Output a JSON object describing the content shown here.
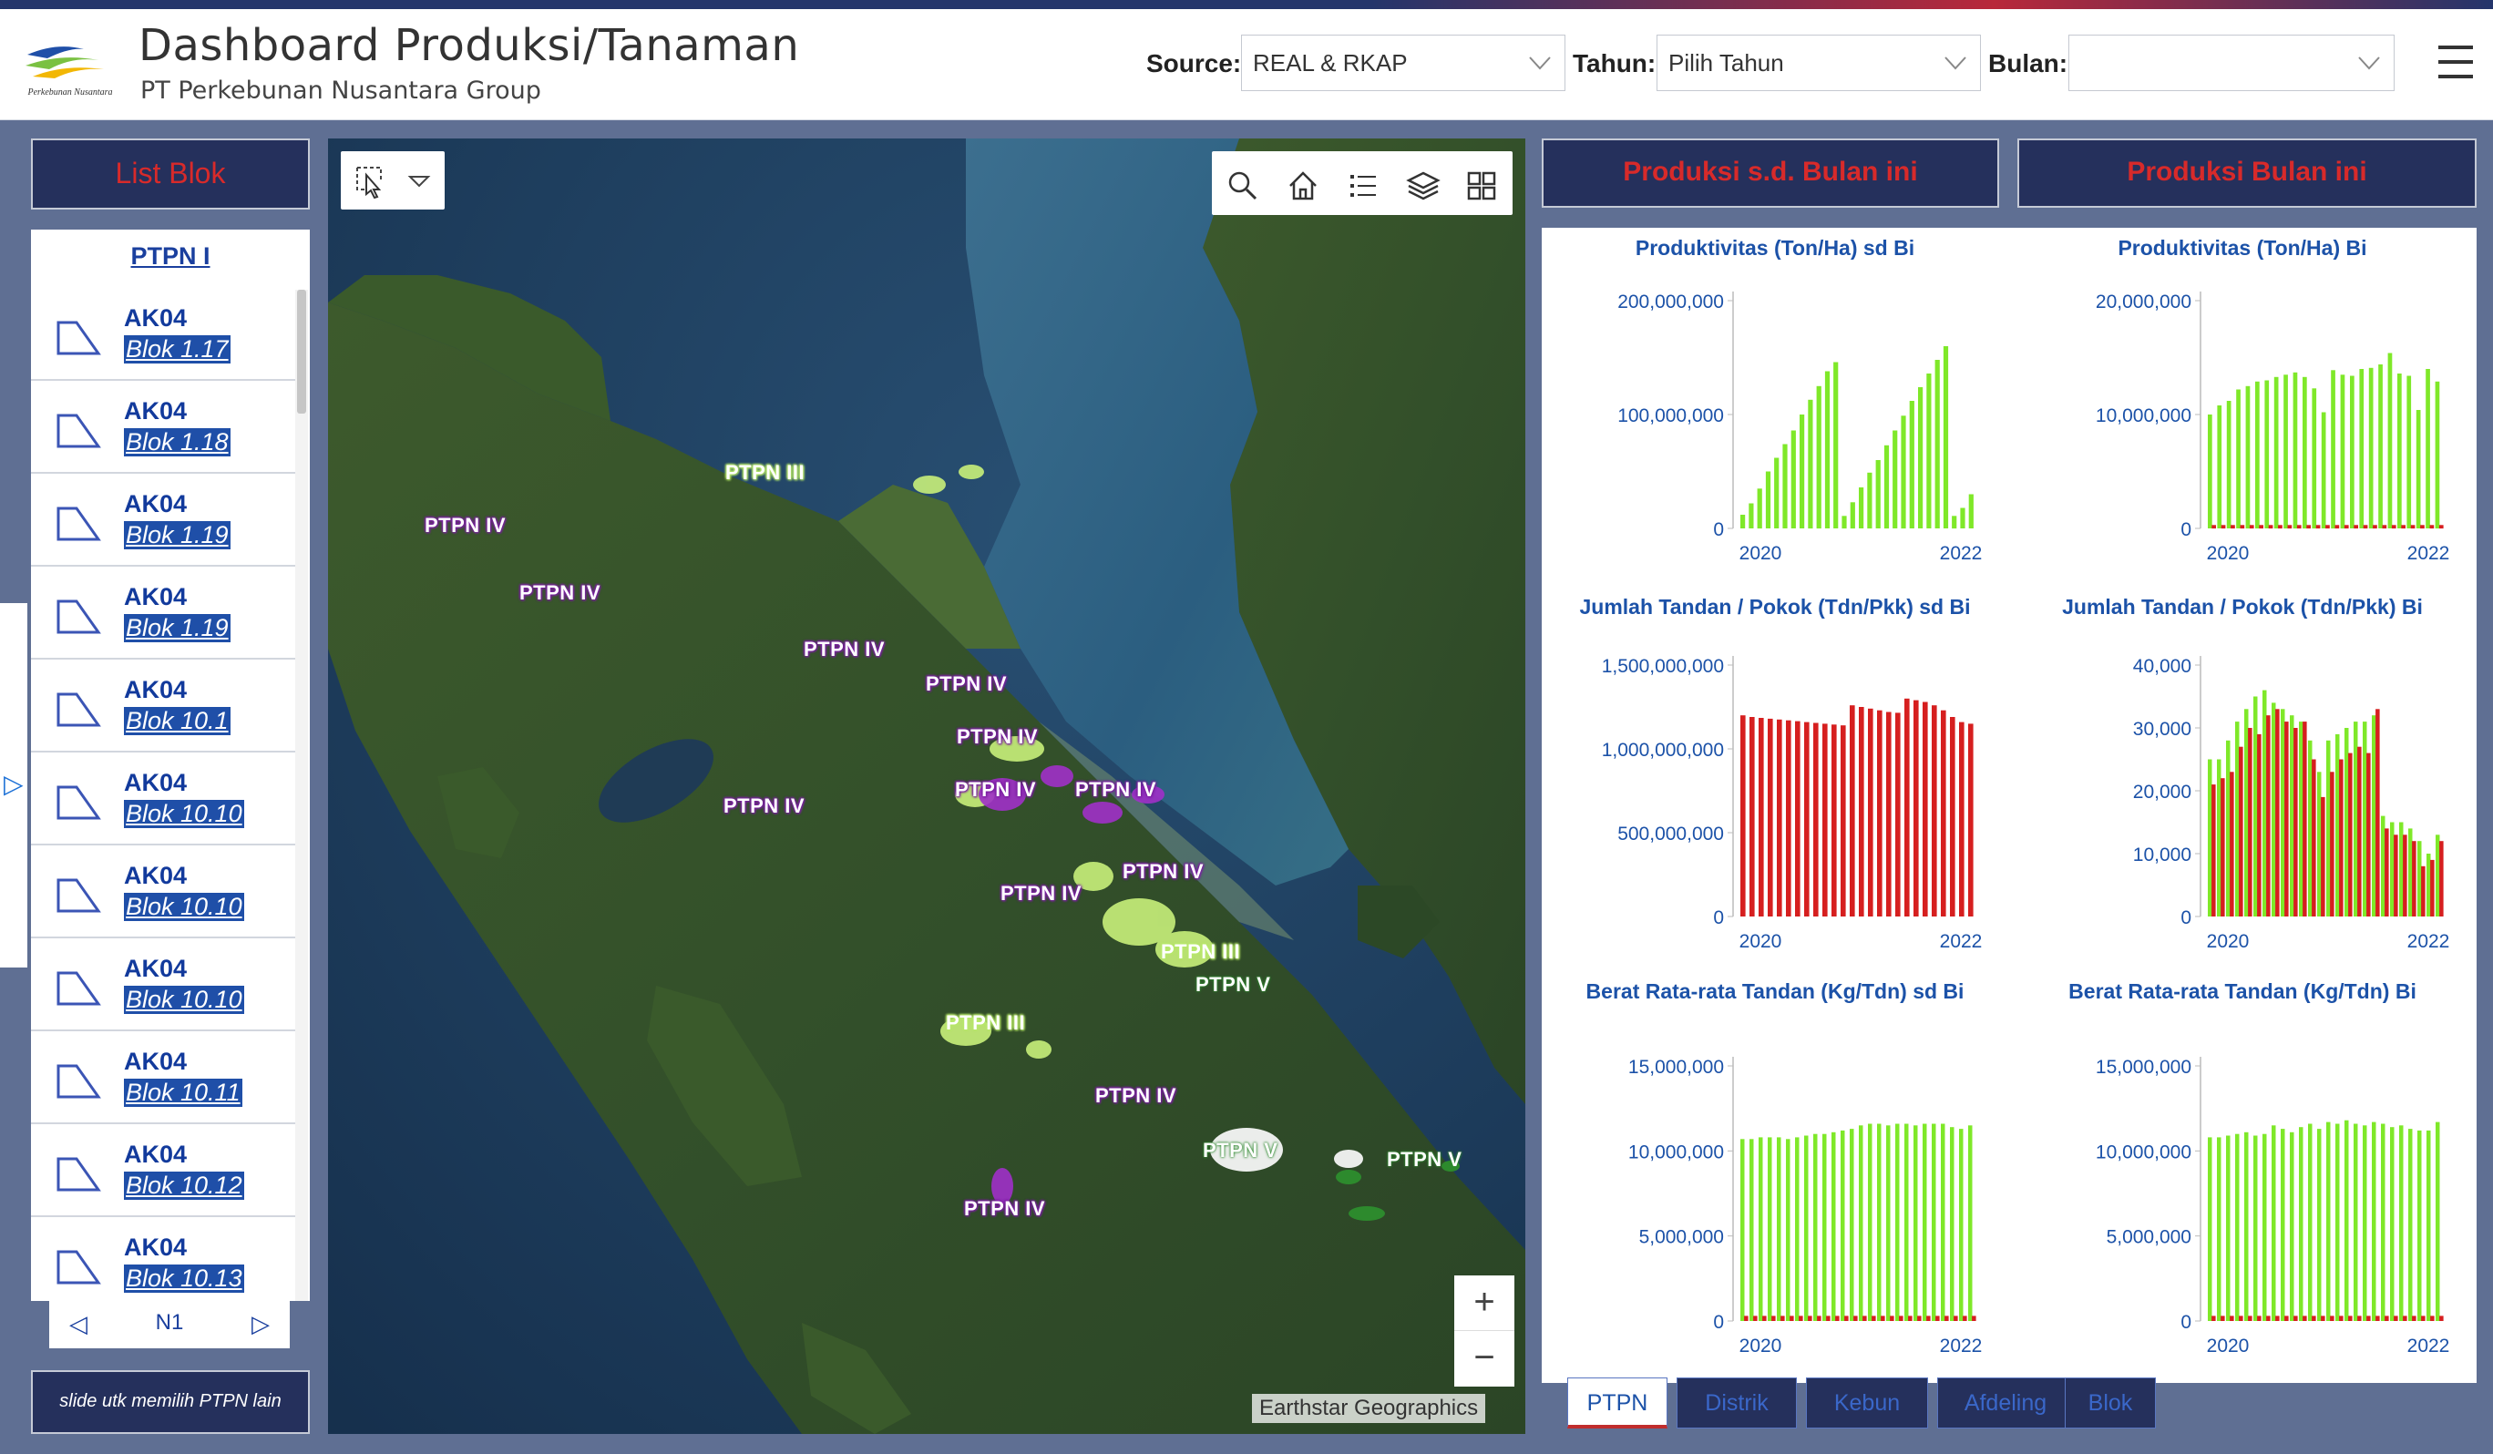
{
  "header": {
    "title": "Dashboard Produksi/Tanaman",
    "subtitle": "PT Perkebunan Nusantara Group",
    "logo_caption": "Perkebunan Nusantara",
    "source_label": "Source:",
    "source_value": "REAL & RKAP",
    "tahun_label": "Tahun:",
    "tahun_value": "Pilih Tahun",
    "bulan_label": "Bulan:",
    "bulan_value": ""
  },
  "list_panel": {
    "title": "List Blok",
    "group": "PTPN I",
    "items": [
      {
        "code": "AK04",
        "name": "Blok 1.17"
      },
      {
        "code": "AK04",
        "name": "Blok 1.18"
      },
      {
        "code": "AK04",
        "name": "Blok 1.19"
      },
      {
        "code": "AK04",
        "name": "Blok 1.19"
      },
      {
        "code": "AK04",
        "name": "Blok 10.1"
      },
      {
        "code": "AK04",
        "name": "Blok 10.10"
      },
      {
        "code": "AK04",
        "name": "Blok 10.10"
      },
      {
        "code": "AK04",
        "name": "Blok 10.10"
      },
      {
        "code": "AK04",
        "name": "Blok 10.11"
      },
      {
        "code": "AK04",
        "name": "Blok 10.12"
      },
      {
        "code": "AK04",
        "name": "Blok 10.13"
      }
    ],
    "pager": {
      "prev": "◁",
      "page": "N1",
      "next": "▷"
    },
    "slide_button": "slide utk memilih PTPN lain"
  },
  "map": {
    "attribution": "Earthstar Geographics",
    "zoom_in": "+",
    "zoom_out": "−",
    "toolbar_icons": [
      "select-icon",
      "dropdown-icon",
      "search-icon",
      "home-icon",
      "legend-icon",
      "layers-icon",
      "basemap-gallery-icon"
    ],
    "labels": [
      {
        "text": "PTPN III",
        "cls": "iii"
      },
      {
        "text": "PTPN IV",
        "cls": "iv"
      },
      {
        "text": "PTPN IV",
        "cls": "iv"
      },
      {
        "text": "PTPN IV",
        "cls": "iv"
      },
      {
        "text": "PTPN IV",
        "cls": "iv"
      },
      {
        "text": "PTPN IV",
        "cls": "iv"
      },
      {
        "text": "PTPN IV",
        "cls": "iv"
      },
      {
        "text": "PTPN IV",
        "cls": "iv"
      },
      {
        "text": "PTPN IV",
        "cls": "iv"
      },
      {
        "text": "PTPN IV",
        "cls": "iv"
      },
      {
        "text": "PTPN IV",
        "cls": "iv"
      },
      {
        "text": "PTPN III",
        "cls": "iii"
      },
      {
        "text": "PTPN V",
        "cls": "v"
      },
      {
        "text": "PTPN III",
        "cls": "iii"
      },
      {
        "text": "PTPN IV",
        "cls": "iv"
      },
      {
        "text": "PTPN V",
        "cls": "v"
      },
      {
        "text": "PTPN V",
        "cls": "v"
      },
      {
        "text": "PTPN IV",
        "cls": "iv"
      }
    ]
  },
  "right_panel": {
    "head_left": "Produksi s.d. Bulan ini",
    "head_right": "Produksi Bulan ini",
    "tabs": [
      "PTPN",
      "Distrik",
      "Kebun",
      "Afdeling",
      "Blok"
    ],
    "active_tab": "PTPN",
    "colors": {
      "green": "#7fe829",
      "red": "#d61f1f"
    }
  },
  "chart_data": [
    {
      "type": "bar",
      "title": "Produktivitas (Ton/Ha) sd Bi",
      "x_ticks": [
        "2020",
        "2022"
      ],
      "y_ticks": [
        "200,000,000",
        "100,000,000",
        "0"
      ],
      "ylim": [
        0,
        200000000
      ],
      "series": [
        {
          "color": "#7fe829",
          "values": [
            12000000,
            22000000,
            35000000,
            50000000,
            62000000,
            74000000,
            86000000,
            100000000,
            113000000,
            125000000,
            138000000,
            146000000,
            11000000,
            23000000,
            36000000,
            49000000,
            60000000,
            73000000,
            86000000,
            99000000,
            112000000,
            124000000,
            136000000,
            148000000,
            160000000,
            11000000,
            18000000,
            30000000
          ]
        }
      ]
    },
    {
      "type": "bar",
      "title": "Produktivitas (Ton/Ha) Bi",
      "x_ticks": [
        "2020",
        "2022"
      ],
      "y_ticks": [
        "20,000,000",
        "10,000,000",
        "0"
      ],
      "ylim": [
        0,
        20000000
      ],
      "series": [
        {
          "color": "#7fe829",
          "values": [
            10000000,
            10800000,
            11200000,
            12200000,
            12500000,
            12900000,
            13000000,
            13300000,
            13500000,
            13700000,
            13300000,
            12300000,
            10200000,
            13900000,
            13500000,
            13400000,
            14000000,
            14100000,
            14400000,
            15400000,
            13600000,
            13400000,
            10400000,
            14000000,
            12900000
          ]
        },
        {
          "color": "#d61f1f",
          "values": [
            300000,
            300000,
            300000,
            300000,
            300000,
            300000,
            300000,
            300000,
            300000,
            300000,
            300000,
            300000,
            300000,
            300000,
            300000,
            300000,
            300000,
            300000,
            300000,
            300000,
            300000,
            300000,
            300000,
            300000,
            300000
          ]
        }
      ]
    },
    {
      "type": "bar",
      "title": "Jumlah Tandan / Pokok (Tdn/Pkk) sd Bi",
      "x_ticks": [
        "2020",
        "2022"
      ],
      "y_ticks": [
        "1,500,000,000",
        "1,000,000,000",
        "500,000,000",
        "0"
      ],
      "ylim": [
        0,
        1500000000
      ],
      "series": [
        {
          "color": "#d61f1f",
          "values": [
            1200000000,
            1190000000,
            1185000000,
            1180000000,
            1175000000,
            1170000000,
            1165000000,
            1160000000,
            1155000000,
            1150000000,
            1145000000,
            1140000000,
            1260000000,
            1250000000,
            1240000000,
            1230000000,
            1220000000,
            1215000000,
            1300000000,
            1290000000,
            1280000000,
            1260000000,
            1230000000,
            1190000000,
            1160000000,
            1150000000
          ]
        }
      ]
    },
    {
      "type": "bar",
      "title": "Jumlah Tandan / Pokok (Tdn/Pkk) Bi",
      "x_ticks": [
        "2020",
        "2022"
      ],
      "y_ticks": [
        "40,000",
        "30,000",
        "20,000",
        "10,000",
        "0"
      ],
      "ylim": [
        0,
        40000
      ],
      "series": [
        {
          "color": "#7fe829",
          "values": [
            25000,
            25000,
            28000,
            31000,
            33000,
            35000,
            36000,
            34000,
            33000,
            32000,
            31000,
            28000,
            23000,
            28000,
            29000,
            30000,
            31000,
            31000,
            32000,
            16000,
            15000,
            15000,
            14000,
            12000,
            10000,
            13000
          ]
        },
        {
          "color": "#d61f1f",
          "values": [
            21000,
            22000,
            23000,
            27000,
            30000,
            29000,
            32000,
            33000,
            31000,
            30000,
            31000,
            25000,
            19000,
            23000,
            25000,
            26000,
            27000,
            26000,
            33000,
            14000,
            13000,
            13000,
            12000,
            8000,
            9000,
            12000
          ]
        }
      ]
    },
    {
      "type": "bar",
      "title": "Berat Rata-rata Tandan (Kg/Tdn) sd Bi",
      "x_ticks": [
        "2020",
        "2022"
      ],
      "y_ticks": [
        "15,000,000",
        "10,000,000",
        "5,000,000",
        "0"
      ],
      "ylim": [
        0,
        15000000
      ],
      "series": [
        {
          "color": "#7fe829",
          "values": [
            10700000,
            10700000,
            10800000,
            10800000,
            10800000,
            10700000,
            10800000,
            10900000,
            11000000,
            11000000,
            11100000,
            11200000,
            11300000,
            11500000,
            11600000,
            11600000,
            11500000,
            11600000,
            11600000,
            11500000,
            11600000,
            11600000,
            11600000,
            11400000,
            11300000,
            11500000
          ]
        },
        {
          "color": "#d61f1f",
          "values": [
            300000,
            300000,
            300000,
            300000,
            300000,
            300000,
            300000,
            300000,
            300000,
            300000,
            300000,
            300000,
            300000,
            300000,
            300000,
            300000,
            300000,
            300000,
            300000,
            300000,
            300000,
            300000,
            300000,
            300000,
            300000,
            300000
          ]
        }
      ]
    },
    {
      "type": "bar",
      "title": "Berat Rata-rata Tandan (Kg/Tdn) Bi",
      "x_ticks": [
        "2020",
        "2022"
      ],
      "y_ticks": [
        "15,000,000",
        "10,000,000",
        "5,000,000",
        "0"
      ],
      "ylim": [
        0,
        15000000
      ],
      "series": [
        {
          "color": "#7fe829",
          "values": [
            10800000,
            10800000,
            10900000,
            11000000,
            11100000,
            10900000,
            11000000,
            11500000,
            11300000,
            11100000,
            11400000,
            11600000,
            11300000,
            11700000,
            11600000,
            11800000,
            11600000,
            11500000,
            11700000,
            11600000,
            11400000,
            11500000,
            11300000,
            11200000,
            11200000,
            11700000
          ]
        },
        {
          "color": "#d61f1f",
          "values": [
            300000,
            300000,
            300000,
            300000,
            300000,
            300000,
            300000,
            300000,
            300000,
            300000,
            300000,
            300000,
            300000,
            300000,
            300000,
            300000,
            300000,
            300000,
            300000,
            300000,
            300000,
            300000,
            300000,
            300000,
            300000,
            300000
          ]
        }
      ]
    }
  ]
}
